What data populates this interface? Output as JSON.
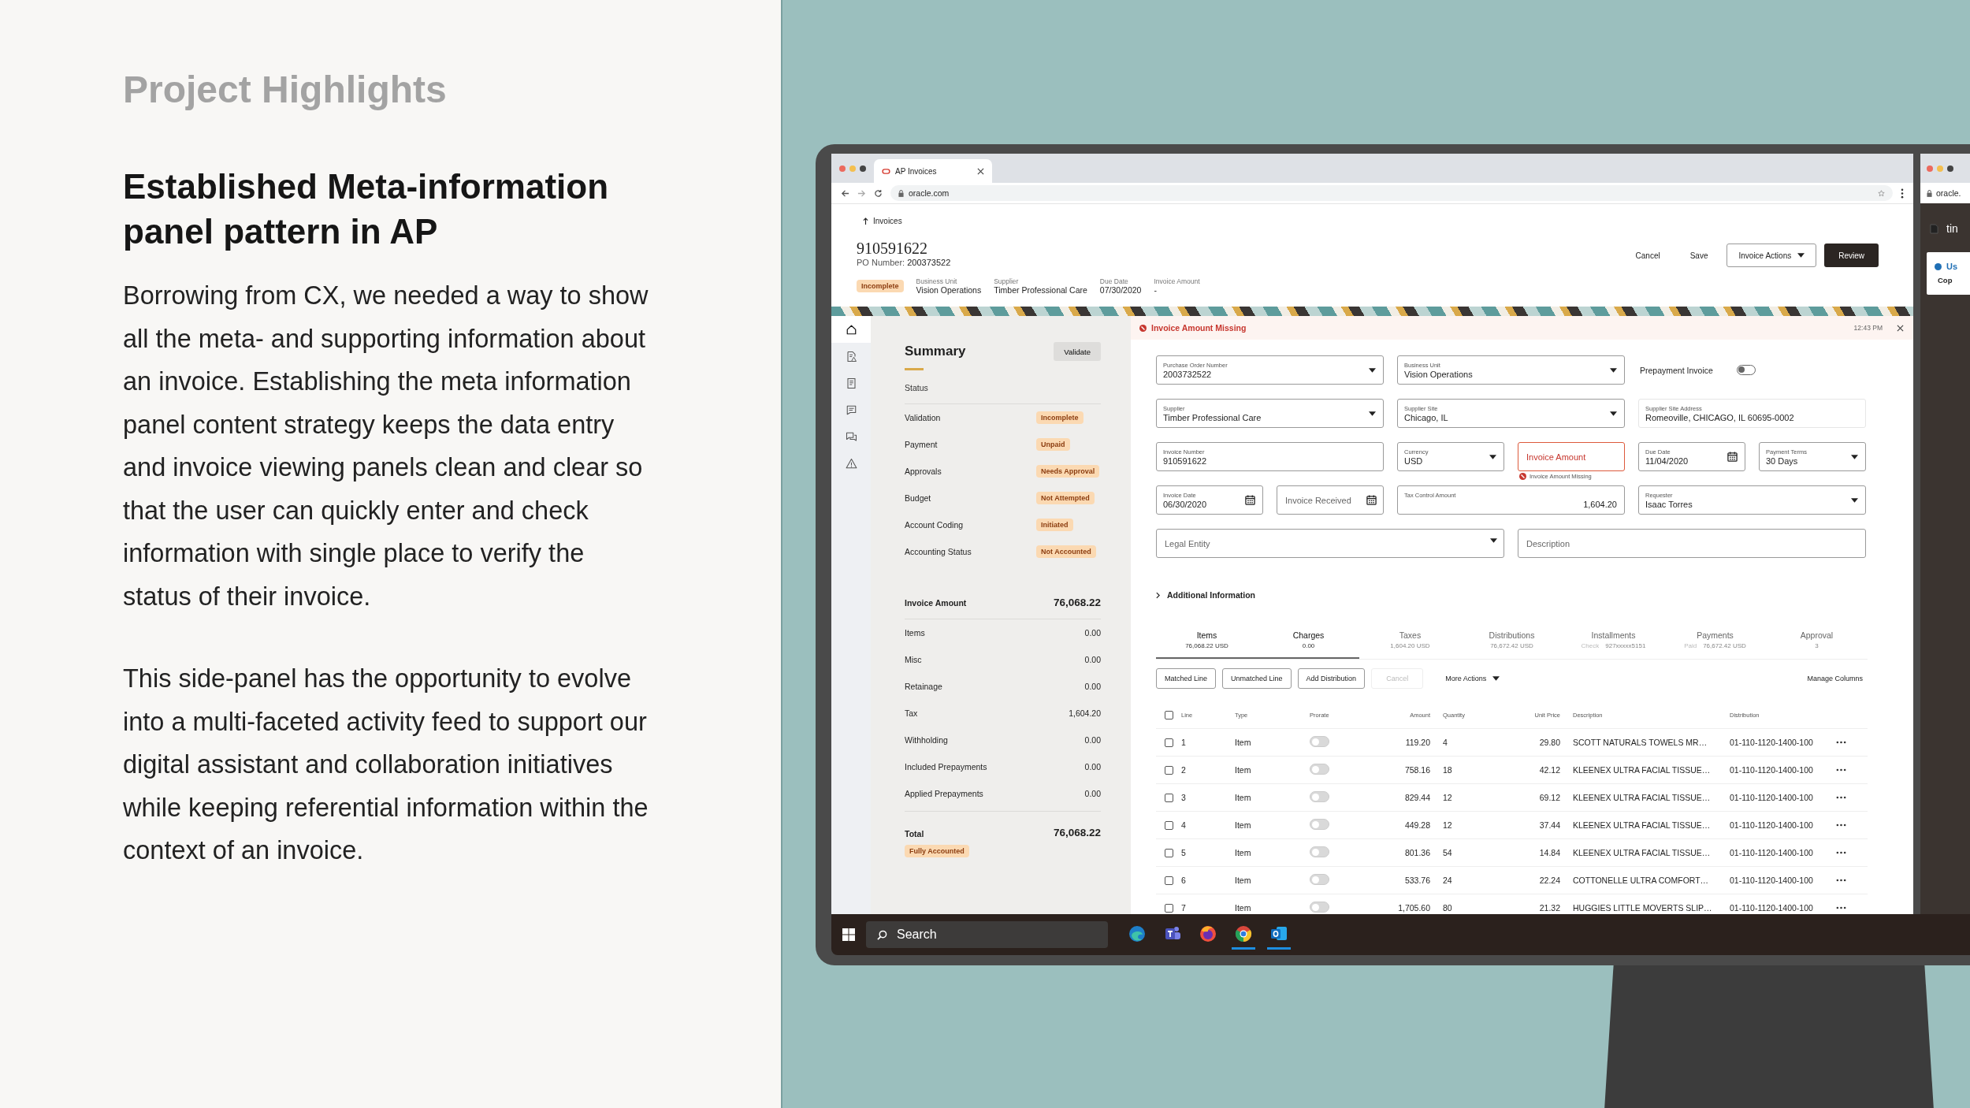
{
  "slide": {
    "eyebrow": "Project Highlights",
    "heading": "Established Meta-information panel pattern in AP",
    "paragraphs": [
      "Borrowing from CX, we needed a way to show all the meta- and supporting information about an invoice. Establishing the meta information panel content strategy keeps the data entry and invoice viewing panels clean and clear so that the user can quickly enter and check information with single place to verify the status of their invoice.",
      "This side-panel has the opportunity to evolve into a multi-faceted activity feed to support our digital assistant and collaboration initiatives while keeping referential information within the context of an invoice."
    ]
  },
  "browser": {
    "tab_title": "AP Invoices",
    "url": "oracle.com"
  },
  "header": {
    "back_link": "Invoices",
    "invoice_number": "910591622",
    "po_label": "PO Number:",
    "po_number": "200373522",
    "status_badge": "Incomplete",
    "meta": [
      {
        "label": "Business Unit",
        "value": "Vision Operations"
      },
      {
        "label": "Supplier",
        "value": "Timber Professional Care"
      },
      {
        "label": "Due Date",
        "value": "07/30/2020"
      },
      {
        "label": "Invoice Amount",
        "value": "-"
      }
    ],
    "actions": [
      {
        "label": "Cancel",
        "kind": "text"
      },
      {
        "label": "Save",
        "kind": "text"
      },
      {
        "label": "Invoice Actions",
        "kind": "menu"
      },
      {
        "label": "Review",
        "kind": "primary"
      }
    ]
  },
  "rail": [
    {
      "selected": true
    },
    {
      "selected": false
    },
    {
      "selected": false
    },
    {
      "selected": false
    },
    {
      "selected": false
    },
    {
      "selected": false
    }
  ],
  "summary": {
    "title": "Summary",
    "validate_button": "Validate",
    "status_heading": "Status",
    "statuses": [
      {
        "label": "Validation",
        "badge": "Incomplete"
      },
      {
        "label": "Payment",
        "badge": "Unpaid"
      },
      {
        "label": "Approvals",
        "badge": "Needs Approval"
      },
      {
        "label": "Budget",
        "badge": "Not Attempted"
      },
      {
        "label": "Account Coding",
        "badge": "Initiated"
      },
      {
        "label": "Accounting Status",
        "badge": "Not Accounted"
      }
    ],
    "amount_label": "Invoice Amount",
    "amount": "76,068.22",
    "lines": [
      {
        "label": "Items",
        "value": "0.00"
      },
      {
        "label": "Misc",
        "value": "0.00"
      },
      {
        "label": "Retainage",
        "value": "0.00"
      },
      {
        "label": "Tax",
        "value": "1,604.20"
      },
      {
        "label": "Withholding",
        "value": "0.00"
      },
      {
        "label": "Included Prepayments",
        "value": "0.00"
      },
      {
        "label": "Applied Prepayments",
        "value": "0.00"
      }
    ],
    "total_label": "Total",
    "total": "76,068.22",
    "total_badge": "Fully Accounted"
  },
  "alert": {
    "message": "Invoice Amount Missing",
    "time": "12:43 PM"
  },
  "form": {
    "rows": [
      [
        {
          "kind": "select",
          "label": "Purchase Order Number",
          "value": "2003732522"
        },
        {
          "kind": "select",
          "label": "Business Unit",
          "value": "Vision Operations"
        },
        {
          "kind": "toggle",
          "label": "Prepayment Invoice",
          "on": false
        }
      ],
      [
        {
          "kind": "select",
          "label": "Supplier",
          "value": "Timber Professional Care"
        },
        {
          "kind": "select",
          "label": "Supplier Site",
          "value": "Chicago, IL"
        },
        {
          "kind": "readonly",
          "label": "Supplier Site Address",
          "value": "Romeoville, CHICAGO, IL 60695-0002"
        }
      ],
      [
        {
          "kind": "text",
          "label": "Invoice Number",
          "value": "910591622"
        },
        {
          "kind": "select",
          "label": "Currency",
          "value": "USD"
        },
        {
          "kind": "text",
          "placeholder": "Invoice Amount",
          "error": "Invoice Amount Missing"
        },
        {
          "kind": "date",
          "label": "Due Date",
          "value": "11/04/2020"
        },
        {
          "kind": "select",
          "label": "Payment Terms",
          "value": "30 Days"
        }
      ],
      [
        {
          "kind": "date",
          "label": "Invoice Date",
          "value": "06/30/2020"
        },
        {
          "kind": "date",
          "placeholder": "Invoice Received"
        },
        {
          "kind": "amount",
          "label": "Tax Control Amount",
          "value": "1,604.20"
        },
        {
          "kind": "select",
          "label": "Requester",
          "value": "Isaac Torres"
        }
      ],
      [
        {
          "kind": "select",
          "placeholder": "Legal Entity"
        },
        {
          "kind": "text",
          "placeholder": "Description"
        }
      ]
    ]
  },
  "additional_info": "Additional Information",
  "tabs": [
    {
      "title": "Items",
      "value": "76,068.22 USD",
      "selected": true
    },
    {
      "title": "Charges",
      "value": "0.00",
      "selected": true
    },
    {
      "title": "Taxes",
      "value": "1,604.20 USD",
      "selected": false
    },
    {
      "title": "Distributions",
      "value": "76,672.42 USD",
      "selected": false
    },
    {
      "title": "Installments",
      "prefix": "Check",
      "value": "927xxxxx5151",
      "selected": false
    },
    {
      "title": "Payments",
      "prefix": "Paid",
      "value": "76,672.42 USD",
      "selected": false
    },
    {
      "title": "Approval",
      "value": "3",
      "selected": false
    }
  ],
  "toolbar": {
    "buttons": [
      {
        "label": "Matched Line",
        "disabled": false
      },
      {
        "label": "Unmatched Line",
        "disabled": false
      },
      {
        "label": "Add Distribution",
        "disabled": false
      },
      {
        "label": "Cancel",
        "disabled": true
      }
    ],
    "more_actions": "More Actions",
    "manage_columns": "Manage Columns"
  },
  "table": {
    "header_checked": false,
    "columns": [
      "Line",
      "Type",
      "Prorate",
      "Amount",
      "Quantity",
      "Unit Price",
      "Description",
      "Distribution"
    ],
    "rows": [
      {
        "checked": false,
        "line": "1",
        "type": "Item",
        "prorate": false,
        "amount": "119.20",
        "quantity": "4",
        "unit_price": "29.80",
        "description": "SCOTT NATURALS TOWELS MR…",
        "distribution": "01-110-1120-1400-100"
      },
      {
        "checked": false,
        "line": "2",
        "type": "Item",
        "prorate": false,
        "amount": "758.16",
        "quantity": "18",
        "unit_price": "42.12",
        "description": "KLEENEX ULTRA FACIAL TISSUE…",
        "distribution": "01-110-1120-1400-100"
      },
      {
        "checked": false,
        "line": "3",
        "type": "Item",
        "prorate": false,
        "amount": "829.44",
        "quantity": "12",
        "unit_price": "69.12",
        "description": "KLEENEX ULTRA FACIAL TISSUE…",
        "distribution": "01-110-1120-1400-100"
      },
      {
        "checked": false,
        "line": "4",
        "type": "Item",
        "prorate": false,
        "amount": "449.28",
        "quantity": "12",
        "unit_price": "37.44",
        "description": "KLEENEX ULTRA FACIAL TISSUE…",
        "distribution": "01-110-1120-1400-100"
      },
      {
        "checked": false,
        "line": "5",
        "type": "Item",
        "prorate": false,
        "amount": "801.36",
        "quantity": "54",
        "unit_price": "14.84",
        "description": "KLEENEX ULTRA FACIAL TISSUE…",
        "distribution": "01-110-1120-1400-100"
      },
      {
        "checked": false,
        "line": "6",
        "type": "Item",
        "prorate": false,
        "amount": "533.76",
        "quantity": "24",
        "unit_price": "22.24",
        "description": "COTTONELLE ULTRA COMFORT…",
        "distribution": "01-110-1120-1400-100"
      },
      {
        "checked": false,
        "line": "7",
        "type": "Item",
        "prorate": false,
        "amount": "1,705.60",
        "quantity": "80",
        "unit_price": "21.32",
        "description": "HUGGIES LITTLE MOVERTS SLIP…",
        "distribution": "01-110-1120-1400-100"
      }
    ]
  },
  "taskbar": {
    "search": "Search",
    "apps": [
      {
        "running": false
      },
      {
        "running": false
      },
      {
        "running": false
      },
      {
        "running": true
      },
      {
        "running": true
      }
    ]
  },
  "side_window": {
    "url": "oracle.",
    "panel_text": "tin",
    "card_title": "Us",
    "card_text": "Cop"
  }
}
